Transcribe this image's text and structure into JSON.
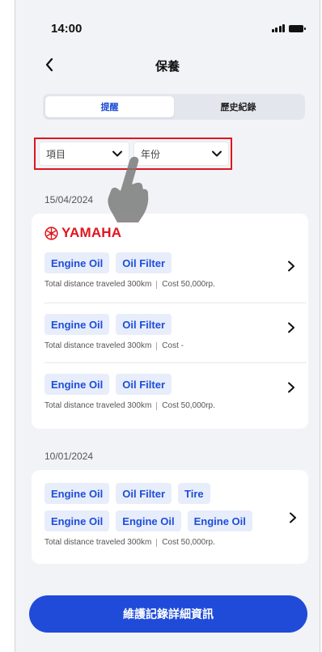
{
  "status_bar": {
    "time": "14:00"
  },
  "nav": {
    "title": "保養"
  },
  "tabs": [
    {
      "label": "提醒",
      "active": true
    },
    {
      "label": "歷史紀錄",
      "active": false
    }
  ],
  "filters": {
    "item": {
      "label": "項目"
    },
    "year": {
      "label": "年份"
    }
  },
  "groups": [
    {
      "date": "15/04/2024",
      "brand": "YAMAHA",
      "entries": [
        {
          "tags": [
            "Engine Oil",
            "Oil Filter"
          ],
          "distance": "Total distance traveled 300km",
          "cost": "Cost 50,000rp."
        },
        {
          "tags": [
            "Engine Oil",
            "Oil Filter"
          ],
          "distance": "Total distance traveled 300km",
          "cost": "Cost -"
        },
        {
          "tags": [
            "Engine Oil",
            "Oil Filter"
          ],
          "distance": "Total distance traveled 300km",
          "cost": "Cost 50,000rp."
        }
      ]
    },
    {
      "date": "10/01/2024",
      "entries": [
        {
          "tags": [
            "Engine Oil",
            "Oil Filter",
            "Tire",
            "Engine Oil",
            "Engine Oil",
            "Engine Oil"
          ],
          "distance": "Total distance traveled 300km",
          "cost": "Cost 50,000rp."
        }
      ]
    }
  ],
  "footer": {
    "button_label": "維護記錄詳細資訊"
  },
  "colors": {
    "accent": "#1f4bd8",
    "brand": "#e0161e",
    "tag_bg": "#e8edfb",
    "highlight": "#e0161e"
  }
}
